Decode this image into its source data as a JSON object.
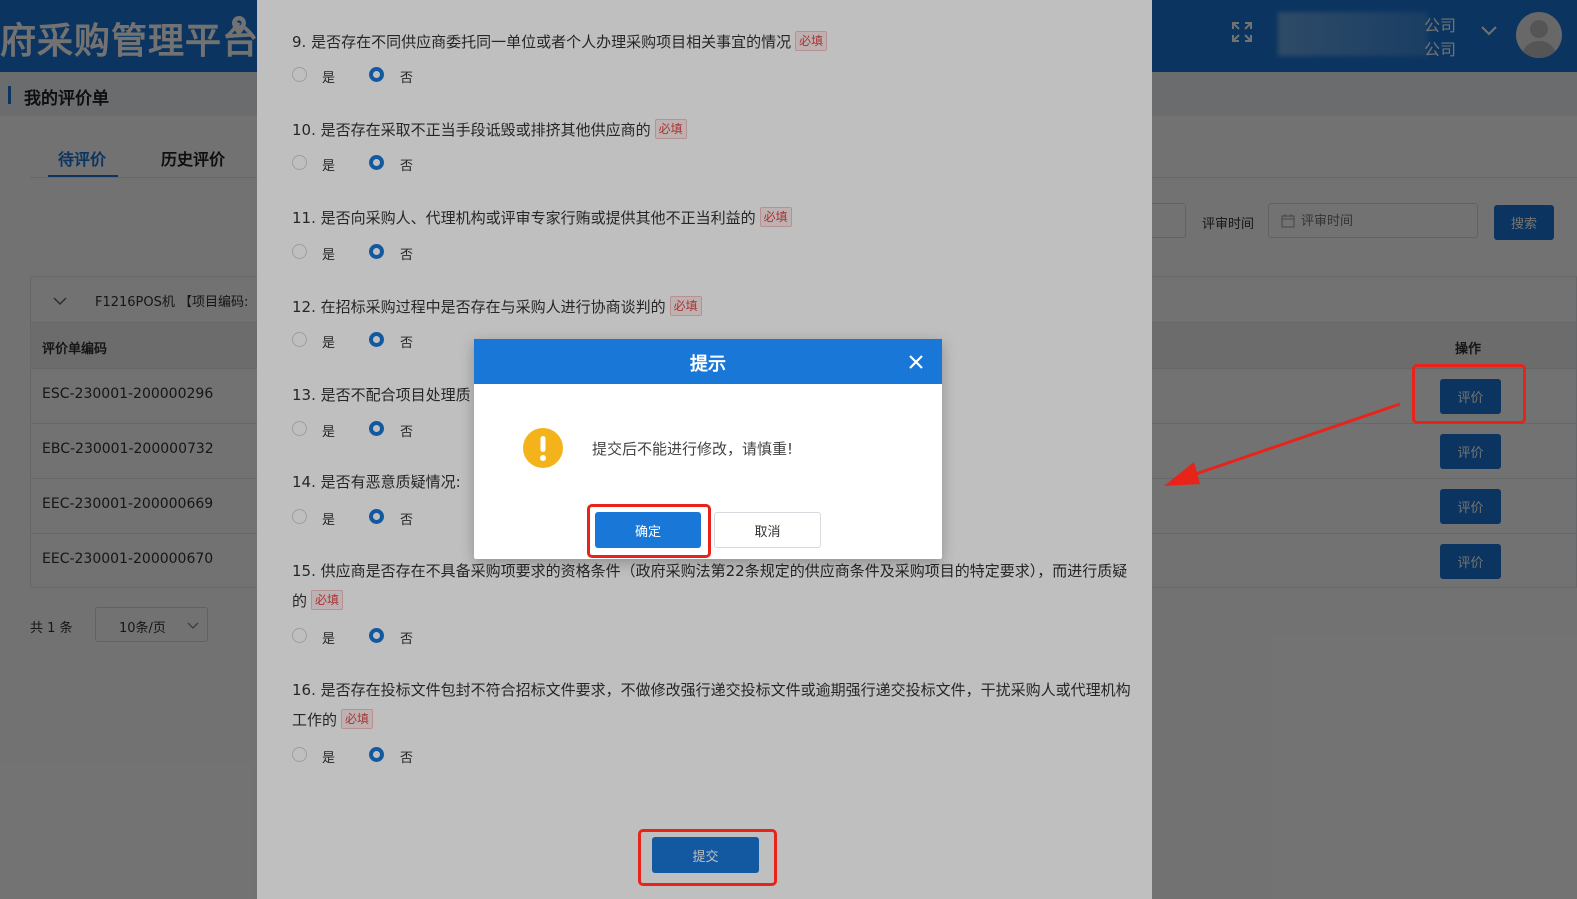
{
  "header": {
    "brand": "府采购管理平台",
    "company_line1": "公司",
    "company_line2": "公司"
  },
  "page_title": "我的评价单",
  "tabs": [
    {
      "label": "待评价",
      "active": true
    },
    {
      "label": "历史评价",
      "active": false
    }
  ],
  "filters": {
    "review_time_label": "评审时间",
    "review_time_placeholder": "评审时间",
    "search_label": "搜索"
  },
  "project": {
    "name": "F1216POS机 【项目编码:"
  },
  "table": {
    "columns": {
      "code": "评价单编码",
      "action": "操作"
    },
    "rows": [
      {
        "code": "ESC-230001-200000296",
        "action": "评价"
      },
      {
        "code": "EBC-230001-200000732",
        "action": "评价"
      },
      {
        "code": "EEC-230001-200000669",
        "action": "评价"
      },
      {
        "code": "EEC-230001-200000670",
        "action": "评价"
      }
    ]
  },
  "pager": {
    "total": "共 1 条",
    "page_size": "10条/页"
  },
  "form": {
    "required_tag": "必填",
    "option_yes": "是",
    "option_no": "否",
    "questions": [
      {
        "text": "9. 是否存在不同供应商委托同一单位或者个人办理采购项目相关事宜的情况",
        "required": true,
        "answer": "否"
      },
      {
        "text": "10. 是否存在采取不正当手段诋毁或排挤其他供应商的",
        "required": true,
        "answer": "否"
      },
      {
        "text": "11. 是否向采购人、代理机构或评审专家行贿或提供其他不正当利益的",
        "required": true,
        "answer": "否"
      },
      {
        "text": "12. 在招标采购过程中是否存在与采购人进行协商谈判的",
        "required": true,
        "answer": "否"
      },
      {
        "text": "13. 是否不配合项目处理质",
        "required": false,
        "answer": "否"
      },
      {
        "text": "14. 是否有恶意质疑情况:",
        "required": false,
        "answer": "否"
      },
      {
        "text": "15. 供应商是否存在不具备采购项要求的资格条件（政府采购法第22条规定的供应商条件及采购项目的特定要求），而进行质疑的",
        "required": true,
        "answer": "否"
      },
      {
        "text": "16. 是否存在投标文件包封不符合招标文件要求，不做修改强行递交投标文件或逾期强行递交投标文件，干扰采购人或代理机构工作的",
        "required": true,
        "answer": "否"
      }
    ],
    "submit_label": "提交"
  },
  "dialog": {
    "title": "提示",
    "message": "提交后不能进行修改，请慎重!",
    "ok_label": "确定",
    "cancel_label": "取消",
    "icon": "warning-icon"
  },
  "colors": {
    "primary": "#1977d8",
    "annotation": "#e8231a",
    "warning": "#f5b31b"
  }
}
